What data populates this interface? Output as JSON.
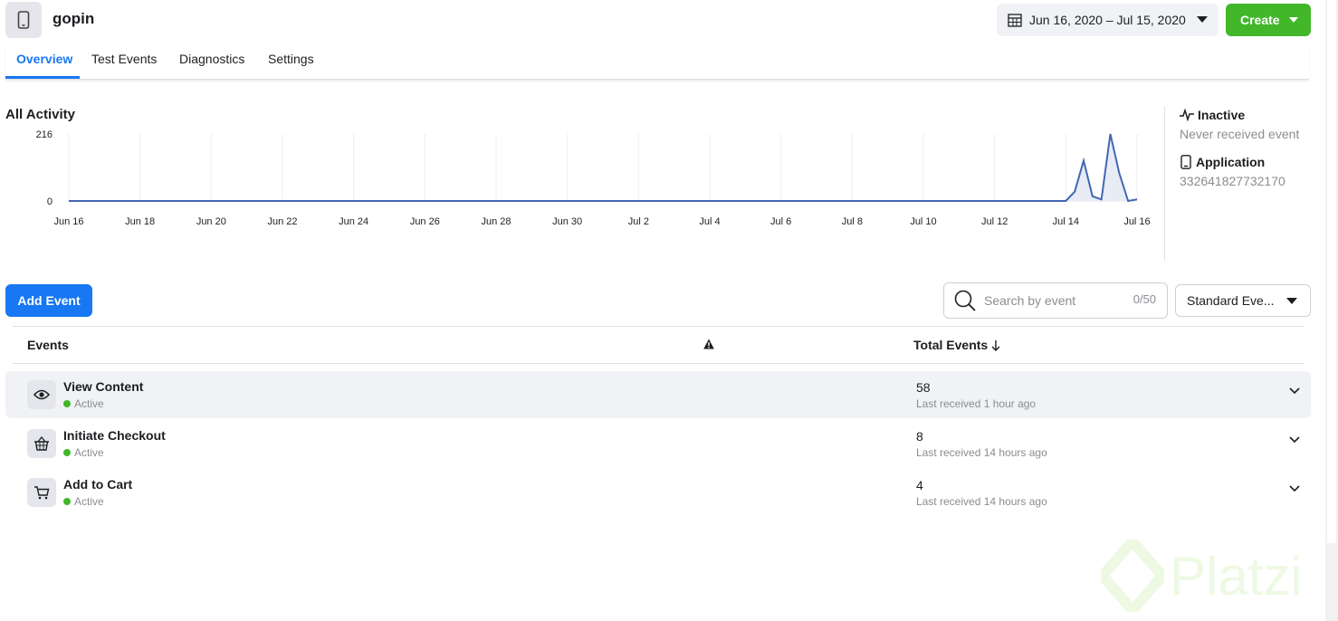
{
  "header": {
    "app_name": "gopin",
    "date_range": "Jun 16, 2020 – Jul 15, 2020",
    "create_label": "Create"
  },
  "tabs": [
    {
      "label": "Overview",
      "active": true
    },
    {
      "label": "Test Events",
      "active": false
    },
    {
      "label": "Diagnostics",
      "active": false
    },
    {
      "label": "Settings",
      "active": false
    }
  ],
  "activity": {
    "title": "All Activity",
    "status_label": "Inactive",
    "status_sub": "Never received event",
    "type_label": "Application",
    "app_id": "332641827732170"
  },
  "chart_data": {
    "type": "line",
    "ylim": [
      0,
      216
    ],
    "y_ticks": [
      "216",
      "0"
    ],
    "x_ticks": [
      "Jun 16",
      "Jun 18",
      "Jun 20",
      "Jun 22",
      "Jun 24",
      "Jun 26",
      "Jun 28",
      "Jun 30",
      "Jul 2",
      "Jul 4",
      "Jul 6",
      "Jul 8",
      "Jul 10",
      "Jul 12",
      "Jul 14",
      "Jul 16"
    ],
    "x_days": [
      0,
      1,
      2,
      3,
      4,
      5,
      6,
      7,
      8,
      9,
      10,
      11,
      12,
      13,
      14,
      15,
      16,
      17,
      18,
      19,
      20,
      21,
      22,
      23,
      24,
      25,
      26,
      27,
      28,
      28.25,
      28.5,
      28.75,
      29,
      29.25,
      29.5,
      29.75,
      30
    ],
    "values": [
      0,
      0,
      0,
      0,
      0,
      0,
      0,
      0,
      0,
      0,
      0,
      0,
      0,
      0,
      0,
      0,
      0,
      0,
      0,
      0,
      0,
      0,
      0,
      0,
      0,
      0,
      0,
      0,
      0,
      30,
      130,
      15,
      5,
      216,
      90,
      0,
      5
    ],
    "color": "#4267b2"
  },
  "controls": {
    "add_event_label": "Add Event",
    "search_placeholder": "Search by event",
    "search_count": "0/50",
    "filter_label": "Standard Eve..."
  },
  "table": {
    "col_events": "Events",
    "col_total": "Total Events",
    "rows": [
      {
        "name": "View Content",
        "status": "Active",
        "count": "58",
        "last": "Last received 1 hour ago",
        "icon": "eye-icon"
      },
      {
        "name": "Initiate Checkout",
        "status": "Active",
        "count": "8",
        "last": "Last received 14 hours ago",
        "icon": "basket-icon"
      },
      {
        "name": "Add to Cart",
        "status": "Active",
        "count": "4",
        "last": "Last received 14 hours ago",
        "icon": "cart-icon"
      }
    ]
  },
  "watermark": "Platzi",
  "colors": {
    "accent": "#1877f2",
    "create": "#42b72a",
    "active_dot": "#42b72a"
  }
}
